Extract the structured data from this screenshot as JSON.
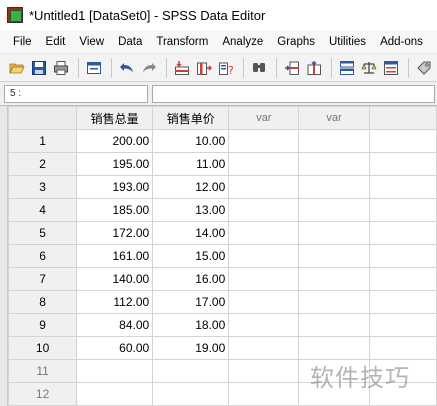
{
  "window": {
    "title": "*Untitled1 [DataSet0] - SPSS Data Editor",
    "app_icon": "spss-app-icon"
  },
  "menu": {
    "items": [
      "File",
      "Edit",
      "View",
      "Data",
      "Transform",
      "Analyze",
      "Graphs",
      "Utilities",
      "Add-ons"
    ]
  },
  "toolbar": {
    "buttons": [
      {
        "name": "open-icon"
      },
      {
        "name": "save-icon"
      },
      {
        "name": "print-icon"
      },
      {
        "name": "dialog-recall-icon"
      },
      {
        "name": "undo-icon"
      },
      {
        "name": "redo-icon"
      },
      {
        "name": "goto-case-icon"
      },
      {
        "name": "goto-variable-icon"
      },
      {
        "name": "variables-icon"
      },
      {
        "name": "find-icon"
      },
      {
        "name": "insert-cases-icon"
      },
      {
        "name": "insert-variable-icon"
      },
      {
        "name": "split-file-icon"
      },
      {
        "name": "weight-cases-icon"
      },
      {
        "name": "select-cases-icon"
      },
      {
        "name": "value-labels-icon"
      }
    ]
  },
  "cell_editor": {
    "cell_ref": "5 :",
    "value": ""
  },
  "grid": {
    "columns": [
      "销售总量",
      "销售单价",
      "var",
      "var"
    ],
    "rows": [
      {
        "num": "1",
        "values": [
          "200.00",
          "10.00",
          "",
          ""
        ]
      },
      {
        "num": "2",
        "values": [
          "195.00",
          "11.00",
          "",
          ""
        ]
      },
      {
        "num": "3",
        "values": [
          "193.00",
          "12.00",
          "",
          ""
        ]
      },
      {
        "num": "4",
        "values": [
          "185.00",
          "13.00",
          "",
          ""
        ]
      },
      {
        "num": "5",
        "values": [
          "172.00",
          "14.00",
          "",
          ""
        ]
      },
      {
        "num": "6",
        "values": [
          "161.00",
          "15.00",
          "",
          ""
        ]
      },
      {
        "num": "7",
        "values": [
          "140.00",
          "16.00",
          "",
          ""
        ]
      },
      {
        "num": "8",
        "values": [
          "112.00",
          "17.00",
          "",
          ""
        ]
      },
      {
        "num": "9",
        "values": [
          "84.00",
          "18.00",
          "",
          ""
        ]
      },
      {
        "num": "10",
        "values": [
          "60.00",
          "19.00",
          "",
          ""
        ]
      },
      {
        "num": "11",
        "values": [
          "",
          "",
          "",
          ""
        ]
      },
      {
        "num": "12",
        "values": [
          "",
          "",
          "",
          ""
        ]
      }
    ]
  },
  "watermark": "软件技巧"
}
